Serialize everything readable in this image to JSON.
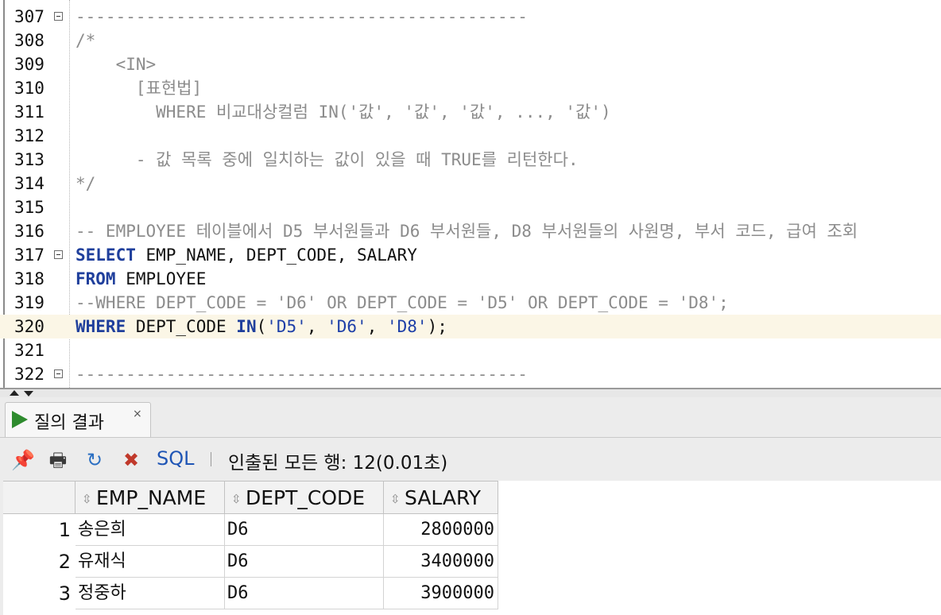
{
  "editor": {
    "lines": [
      {
        "num": "307",
        "fold": true,
        "tokens": [
          {
            "t": "---------------------------------------------",
            "c": "comment"
          }
        ]
      },
      {
        "num": "308",
        "fold": false,
        "tokens": [
          {
            "t": "/*",
            "c": "comment"
          }
        ]
      },
      {
        "num": "309",
        "fold": false,
        "tokens": [
          {
            "t": "    <IN>",
            "c": "comment"
          }
        ]
      },
      {
        "num": "310",
        "fold": false,
        "tokens": [
          {
            "t": "      [표현법]",
            "c": "comment"
          }
        ]
      },
      {
        "num": "311",
        "fold": false,
        "tokens": [
          {
            "t": "        WHERE 비교대상컬럼 IN('값', '값', '값', ..., '값')",
            "c": "comment"
          }
        ]
      },
      {
        "num": "312",
        "fold": false,
        "tokens": [
          {
            "t": "",
            "c": "comment"
          }
        ]
      },
      {
        "num": "313",
        "fold": false,
        "tokens": [
          {
            "t": "      - 값 목록 중에 일치하는 값이 있을 때 TRUE를 리턴한다.",
            "c": "comment"
          }
        ]
      },
      {
        "num": "314",
        "fold": false,
        "tokens": [
          {
            "t": "*/",
            "c": "comment"
          }
        ]
      },
      {
        "num": "315",
        "fold": false,
        "tokens": [
          {
            "t": "",
            "c": "comment"
          }
        ]
      },
      {
        "num": "316",
        "fold": false,
        "tokens": [
          {
            "t": "-- EMPLOYEE 테이블에서 D5 부서원들과 D6 부서원들, D8 부서원들의 사원명, 부서 코드, 급여 조회",
            "c": "comment"
          }
        ]
      },
      {
        "num": "317",
        "fold": true,
        "tokens": [
          {
            "t": "SELECT",
            "c": "kw"
          },
          {
            "t": " EMP_NAME, DEPT_CODE, SALARY",
            "c": "plain"
          }
        ]
      },
      {
        "num": "318",
        "fold": false,
        "tokens": [
          {
            "t": "FROM",
            "c": "kw"
          },
          {
            "t": " EMPLOYEE",
            "c": "plain"
          }
        ]
      },
      {
        "num": "319",
        "fold": false,
        "tokens": [
          {
            "t": "--WHERE DEPT_CODE = 'D6' OR DEPT_CODE = 'D5' OR DEPT_CODE = 'D8';",
            "c": "comment"
          }
        ]
      },
      {
        "num": "320",
        "fold": false,
        "current": true,
        "tokens": [
          {
            "t": "WHERE",
            "c": "kw"
          },
          {
            "t": " DEPT_CODE ",
            "c": "plain"
          },
          {
            "t": "IN",
            "c": "kw"
          },
          {
            "t": "(",
            "c": "plain"
          },
          {
            "t": "'D5'",
            "c": "str"
          },
          {
            "t": ", ",
            "c": "plain"
          },
          {
            "t": "'D6'",
            "c": "str"
          },
          {
            "t": ", ",
            "c": "plain"
          },
          {
            "t": "'D8'",
            "c": "str"
          },
          {
            "t": ");",
            "c": "plain"
          }
        ]
      },
      {
        "num": "321",
        "fold": false,
        "tokens": [
          {
            "t": "",
            "c": "comment"
          }
        ]
      },
      {
        "num": "322",
        "fold": true,
        "tokens": [
          {
            "t": "---------------------------------------------",
            "c": "comment"
          }
        ]
      }
    ]
  },
  "panel": {
    "tab_label": "질의 결과",
    "tab_close": "×",
    "toolbar": {
      "pin_icon": "📌",
      "print_icon": "🖶",
      "refresh_icon": "↻",
      "clear_icon": "✖",
      "sql_label": "SQL",
      "status": "인출된 모든 행: 12(0.01초)"
    }
  },
  "grid": {
    "columns": [
      "EMP_NAME",
      "DEPT_CODE",
      "SALARY"
    ],
    "sort_glyph": "⇳",
    "rows": [
      {
        "n": "1",
        "emp_name": "송은희",
        "dept_code": "D6",
        "salary": "2800000"
      },
      {
        "n": "2",
        "emp_name": "유재식",
        "dept_code": "D6",
        "salary": "3400000"
      },
      {
        "n": "3",
        "emp_name": "정중하",
        "dept_code": "D6",
        "salary": "3900000"
      }
    ]
  }
}
